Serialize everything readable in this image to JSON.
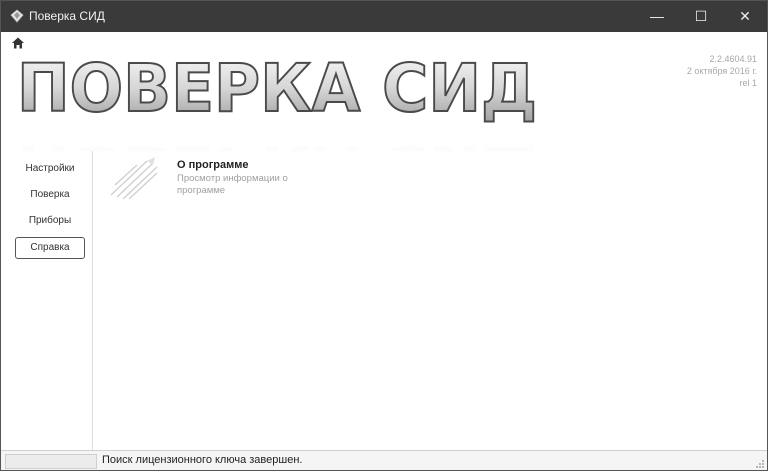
{
  "window": {
    "title": "Поверка СИД",
    "controls": {
      "minimize": "—",
      "maximize": "☐",
      "close": "✕"
    }
  },
  "toolbar": {
    "home_icon": "home-icon"
  },
  "header": {
    "logo_text": "ПОВЕРКА СИД",
    "version_lines": [
      "2.2.4604.91",
      "2 октября 2016 г.",
      "rel 1"
    ]
  },
  "sidebar": {
    "items": [
      {
        "label": "Настройки",
        "active": false
      },
      {
        "label": "Поверка",
        "active": false
      },
      {
        "label": "Приборы",
        "active": false
      },
      {
        "label": "Справка",
        "active": true
      }
    ]
  },
  "content": {
    "items": [
      {
        "icon": "info-document-icon",
        "title": "О программе",
        "description": "Просмотр информации о программе"
      }
    ]
  },
  "status": {
    "text": "Поиск лицензионного ключа завершен."
  },
  "colors": {
    "titlebar": "#3a3a3a",
    "background": "#ffffff",
    "muted_text": "#a0a0a0"
  }
}
